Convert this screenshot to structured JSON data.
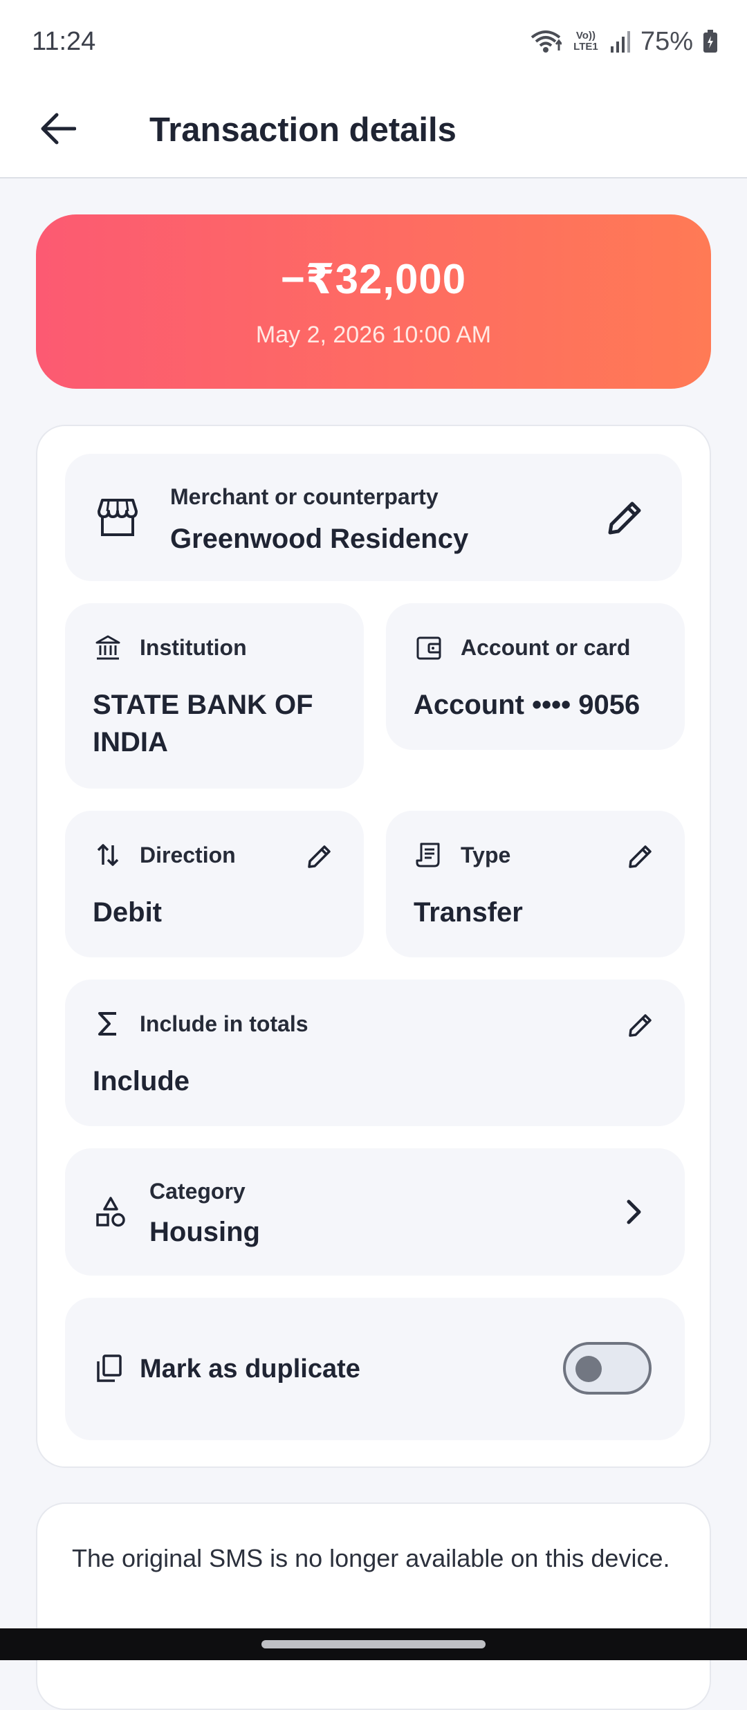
{
  "status_bar": {
    "time": "11:24",
    "network_label": "Vo)) LTE1",
    "battery": "75%"
  },
  "app_bar": {
    "title": "Transaction details",
    "back_icon": "arrow-back-icon"
  },
  "hero": {
    "amount": "−₹32,000",
    "date": "May 2, 2026 10:00 AM",
    "gradient_start": "#fc5a72",
    "gradient_end": "#ff7a55"
  },
  "details": {
    "merchant": {
      "label": "Merchant or counterparty",
      "value": "Greenwood Residency",
      "icon": "storefront-icon"
    },
    "institution": {
      "label": "Institution",
      "value": "STATE BANK OF INDIA",
      "icon": "bank-icon"
    },
    "account": {
      "label": "Account or card",
      "value": "Account •••• 9056",
      "icon": "wallet-icon"
    },
    "direction": {
      "label": "Direction",
      "value": "Debit",
      "icon": "swap-vertical-icon"
    },
    "type": {
      "label": "Type",
      "value": "Transfer",
      "icon": "receipt-icon"
    },
    "include_totals": {
      "label": "Include in totals",
      "value": "Include",
      "icon": "sigma-icon"
    },
    "category": {
      "label": "Category",
      "value": "Housing",
      "icon": "category-shapes-icon"
    },
    "duplicate": {
      "label": "Mark as duplicate",
      "icon": "copy-icon",
      "toggle_on": false
    }
  },
  "sms": {
    "text": "The original SMS is no longer available on this device."
  }
}
